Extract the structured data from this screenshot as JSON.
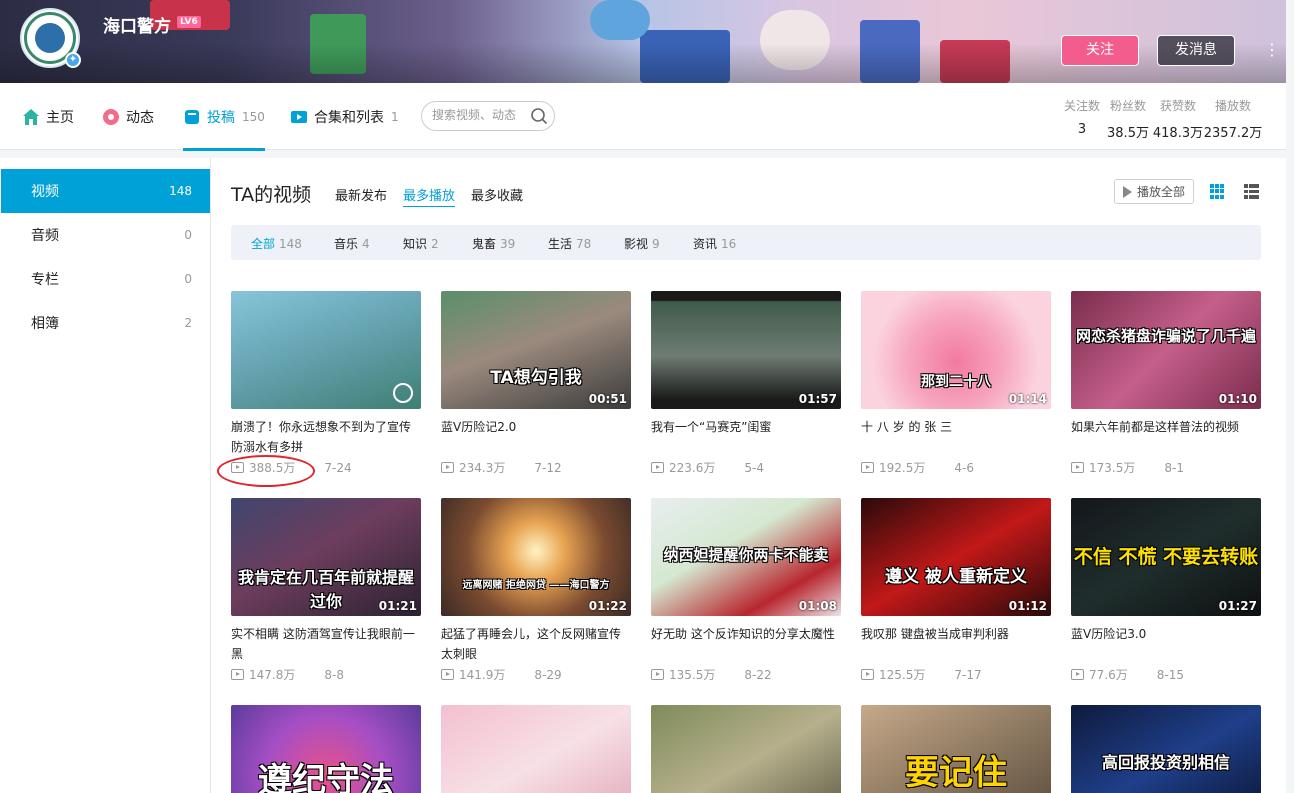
{
  "banner": {
    "username": "海口警方",
    "level": "LV6",
    "follow_label": "关注",
    "message_label": "发消息",
    "more": "⋮"
  },
  "nav": {
    "items": [
      {
        "label": "主页",
        "count": ""
      },
      {
        "label": "动态",
        "count": ""
      },
      {
        "label": "投稿",
        "count": "150"
      },
      {
        "label": "合集和列表",
        "count": "1"
      }
    ],
    "search_placeholder": "搜索视频、动态",
    "stats": [
      {
        "label": "关注数",
        "value": "3"
      },
      {
        "label": "粉丝数",
        "value": "38.5万"
      },
      {
        "label": "获赞数",
        "value": "418.3万"
      },
      {
        "label": "播放数",
        "value": "2357.2万"
      }
    ]
  },
  "sidebar": {
    "items": [
      {
        "label": "视频",
        "count": "148"
      },
      {
        "label": "音频",
        "count": "0"
      },
      {
        "label": "专栏",
        "count": "0"
      },
      {
        "label": "相簿",
        "count": "2"
      }
    ]
  },
  "main": {
    "title": "TA的视频",
    "sort_tabs": [
      "最新发布",
      "最多播放",
      "最多收藏"
    ],
    "play_all": "播放全部",
    "filters": [
      {
        "label": "全部",
        "count": "148"
      },
      {
        "label": "音乐",
        "count": "4"
      },
      {
        "label": "知识",
        "count": "2"
      },
      {
        "label": "鬼畜",
        "count": "39"
      },
      {
        "label": "生活",
        "count": "78"
      },
      {
        "label": "影视",
        "count": "9"
      },
      {
        "label": "资讯",
        "count": "16"
      }
    ],
    "videos": [
      {
        "title": "崩溃了！你永远想象不到为了宣传防溺水有多拼",
        "views": "388.5万",
        "date": "7-24",
        "duration": "",
        "caption": ""
      },
      {
        "title": "蓝V历险记2.0",
        "views": "234.3万",
        "date": "7-12",
        "duration": "00:51",
        "caption": "TA想勾引我"
      },
      {
        "title": "我有一个“马赛克”闺蜜",
        "views": "223.6万",
        "date": "5-4",
        "duration": "01:57",
        "caption": ""
      },
      {
        "title": "十 八 岁 的 张 三",
        "views": "192.5万",
        "date": "4-6",
        "duration": "01:14",
        "caption": "那到二十八"
      },
      {
        "title": "如果六年前都是这样普法的视频",
        "views": "173.5万",
        "date": "8-1",
        "duration": "01:10",
        "caption": "网恋杀猪盘诈骗说了几千遍"
      },
      {
        "title": "实不相瞒 这防酒驾宣传让我眼前一黑",
        "views": "147.8万",
        "date": "8-8",
        "duration": "01:21",
        "caption": "我肯定在几百年前就提醒过你"
      },
      {
        "title": "起猛了再睡会儿，这个反网赌宣传太刺眼",
        "views": "141.9万",
        "date": "8-29",
        "duration": "01:22",
        "caption": "远离网赌 拒绝网贷 ——海口警方"
      },
      {
        "title": "好无助 这个反诈知识的分享太魔性",
        "views": "135.5万",
        "date": "8-22",
        "duration": "01:08",
        "caption": "纳西妲提醒你两卡不能卖"
      },
      {
        "title": "我叹那 键盘被当成审判利器",
        "views": "125.5万",
        "date": "7-17",
        "duration": "01:12",
        "caption": "遵义 被人重新定义"
      },
      {
        "title": "蓝V历险记3.0",
        "views": "77.6万",
        "date": "8-15",
        "duration": "01:27",
        "caption": "不信 不慌 不要去转账"
      },
      {
        "title": "",
        "views": "",
        "date": "",
        "duration": "",
        "caption": "遵纪守法"
      },
      {
        "title": "",
        "views": "",
        "date": "",
        "duration": "",
        "caption": ""
      },
      {
        "title": "",
        "views": "",
        "date": "",
        "duration": "",
        "caption": ""
      },
      {
        "title": "",
        "views": "",
        "date": "",
        "duration": "",
        "caption": "要记住"
      },
      {
        "title": "",
        "views": "",
        "date": "",
        "duration": "",
        "caption": "高回报投资别相信"
      }
    ]
  },
  "colors": {
    "accent": "#00a1d6",
    "follow": "#f25d8e",
    "annotation": "#e0242a"
  }
}
